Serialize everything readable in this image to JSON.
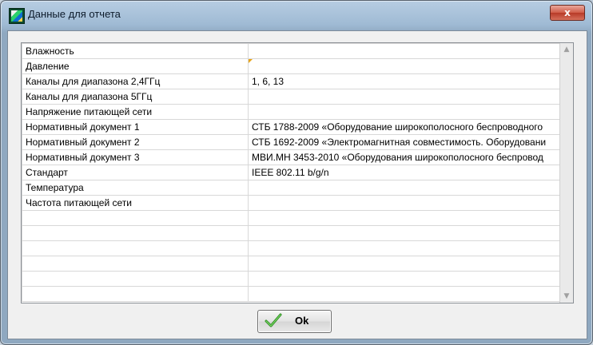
{
  "window": {
    "title": "Данные для отчета"
  },
  "table": {
    "rows": [
      {
        "param": "Влажность",
        "value": ""
      },
      {
        "param": "Давление",
        "value": ""
      },
      {
        "param": "Каналы для диапазона 2,4ГГц",
        "value": "1, 6, 13"
      },
      {
        "param": "Каналы для диапазона 5ГГц",
        "value": ""
      },
      {
        "param": "Напряжение питающей сети",
        "value": ""
      },
      {
        "param": "Нормативный документ 1",
        "value": "СТБ 1788-2009 «Оборудование широкополосного беспроводного"
      },
      {
        "param": "Нормативный документ 2",
        "value": "СТБ 1692-2009 «Электромагнитная совместимость. Оборудовани"
      },
      {
        "param": "Нормативный документ 3",
        "value": "МВИ.МН 3453-2010 «Оборудования широкополосного беспровод"
      },
      {
        "param": "Стандарт",
        "value": "IEEE 802.11 b/g/n"
      },
      {
        "param": "Температура",
        "value": ""
      },
      {
        "param": "Частота питающей сети",
        "value": ""
      },
      {
        "param": "",
        "value": ""
      },
      {
        "param": "",
        "value": ""
      },
      {
        "param": "",
        "value": ""
      },
      {
        "param": "",
        "value": ""
      },
      {
        "param": "",
        "value": ""
      },
      {
        "param": "",
        "value": ""
      }
    ]
  },
  "buttons": {
    "ok_label": "Ok",
    "close_label": "x"
  },
  "icons": {
    "app": "app-icon",
    "ok": "check-icon",
    "scroll_up": "chevron-up-icon",
    "scroll_down": "chevron-down-icon"
  }
}
